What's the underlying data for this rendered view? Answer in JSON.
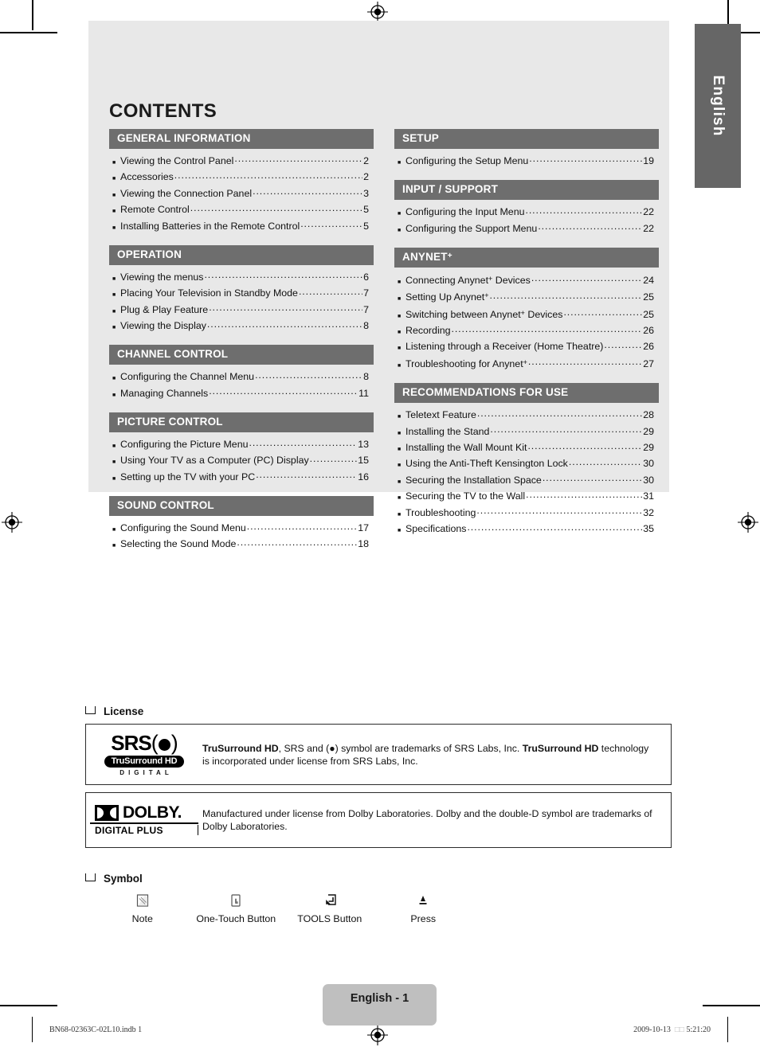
{
  "page": {
    "heading": "CONTENTS",
    "language_tab": "English",
    "page_label": "English - 1"
  },
  "toc": {
    "columns": [
      {
        "sections": [
          {
            "header": "GENERAL INFORMATION",
            "items": [
              {
                "label": "Viewing the Control Panel",
                "page": "2"
              },
              {
                "label": "Accessories",
                "page": "2"
              },
              {
                "label": "Viewing the Connection Panel",
                "page": "3"
              },
              {
                "label": "Remote Control",
                "page": "5"
              },
              {
                "label": "Installing Batteries in the Remote Control",
                "page": "5"
              }
            ]
          },
          {
            "header": "OPERATION",
            "items": [
              {
                "label": "Viewing the menus",
                "page": "6"
              },
              {
                "label": "Placing Your Television in Standby Mode",
                "page": "7"
              },
              {
                "label": "Plug & Play Feature",
                "page": "7"
              },
              {
                "label": "Viewing the Display",
                "page": "8"
              }
            ]
          },
          {
            "header": "CHANNEL CONTROL",
            "items": [
              {
                "label": "Configuring the Channel Menu",
                "page": "8"
              },
              {
                "label": "Managing Channels",
                "page": "11"
              }
            ]
          },
          {
            "header": "PICTURE CONTROL",
            "items": [
              {
                "label": "Configuring the Picture Menu",
                "page": "13"
              },
              {
                "label": "Using Your TV as a Computer (PC) Display",
                "page": "15"
              },
              {
                "label": "Setting up the TV with your PC",
                "page": "16"
              }
            ]
          },
          {
            "header": "SOUND CONTROL",
            "items": [
              {
                "label": "Configuring the Sound Menu",
                "page": "17"
              },
              {
                "label": "Selecting the Sound Mode",
                "page": "18"
              }
            ]
          }
        ]
      },
      {
        "sections": [
          {
            "header": "SETUP",
            "items": [
              {
                "label": "Configuring the Setup Menu",
                "page": "19"
              }
            ]
          },
          {
            "header": "INPUT / SUPPORT",
            "items": [
              {
                "label": "Configuring the Input Menu",
                "page": "22"
              },
              {
                "label": "Configuring the Support Menu",
                "page": "22"
              }
            ]
          },
          {
            "header": "ANYNET+",
            "header_sup": "+",
            "header_base": "ANYNET",
            "items": [
              {
                "label": "Connecting Anynet+ Devices",
                "page": "24"
              },
              {
                "label": "Setting Up Anynet+",
                "page": "25"
              },
              {
                "label": "Switching between Anynet+ Devices",
                "page": "25"
              },
              {
                "label": "Recording",
                "page": "26"
              },
              {
                "label": "Listening through a Receiver (Home Theatre)",
                "page": "26"
              },
              {
                "label": "Troubleshooting for Anynet+",
                "page": "27"
              }
            ]
          },
          {
            "header": "RECOMMENDATIONS FOR USE",
            "items": [
              {
                "label": "Teletext Feature",
                "page": "28"
              },
              {
                "label": "Installing the Stand",
                "page": "29"
              },
              {
                "label": "Installing the Wall Mount Kit",
                "page": "29"
              },
              {
                "label": "Using the Anti-Theft Kensington Lock",
                "page": "30"
              },
              {
                "label": "Securing the Installation Space",
                "page": "30"
              },
              {
                "label": "Securing the TV to the Wall",
                "page": "31"
              },
              {
                "label": "Troubleshooting",
                "page": "32"
              },
              {
                "label": "Specifications",
                "page": "35"
              }
            ]
          }
        ]
      }
    ]
  },
  "license": {
    "section_title": "License",
    "entries": [
      {
        "logo": "srs-trusurround-hd-logo",
        "logo_lines": {
          "brand": "SRS",
          "pill": "TruSurround HD",
          "sub": "DIGITAL"
        },
        "text_lead": "TruSurround HD",
        "text_mid": ", SRS and ",
        "text_sym": "symbol are trademarks of SRS Labs, Inc. ",
        "text_bold2": "TruSurround HD",
        "text_tail": " technology is incorporated under license from SRS Labs, Inc."
      },
      {
        "logo": "dolby-digital-plus-logo",
        "logo_lines": {
          "brand": "DOLBY.",
          "sub": "DIGITAL PLUS"
        },
        "text_plain": "Manufactured under license from Dolby Laboratories. Dolby and the double-D symbol are trademarks of Dolby Laboratories."
      }
    ]
  },
  "symbols": {
    "section_title": "Symbol",
    "items": [
      {
        "icon": "note-icon",
        "caption": "Note"
      },
      {
        "icon": "one-touch-button-icon",
        "caption": "One-Touch Button"
      },
      {
        "icon": "tools-button-icon",
        "caption": "TOOLS Button"
      },
      {
        "icon": "press-icon",
        "caption": "Press"
      }
    ]
  },
  "footer": {
    "file_name": "BN68-02363C-02L10.indb   1",
    "date": "2009-10-13",
    "cjk_marker": "□□",
    "time": "5:21:20"
  },
  "colors": {
    "panel_bg": "#e8e8e8",
    "section_header_bg": "#6e6e6e",
    "lang_tab_bg": "#666666",
    "page_pill_bg": "#bfbfbf"
  }
}
